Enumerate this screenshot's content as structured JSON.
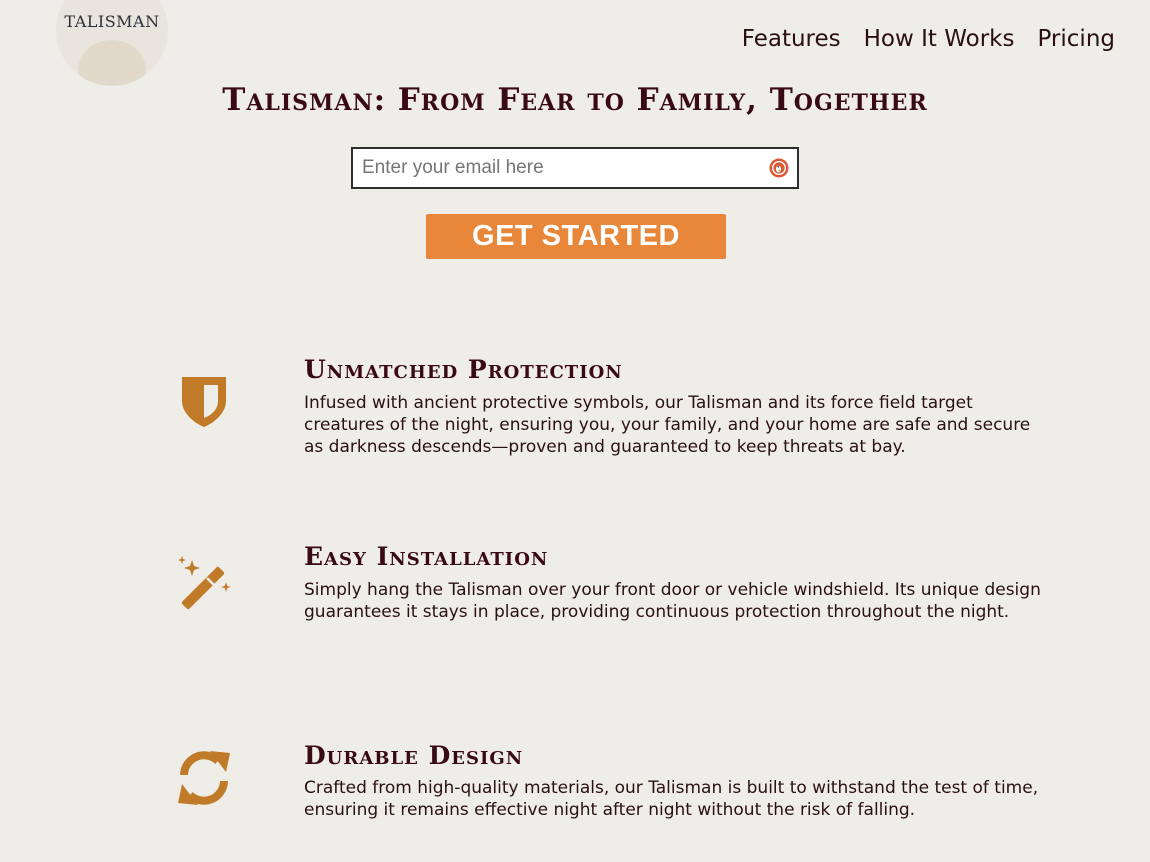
{
  "logo": {
    "text": "TALISMAN"
  },
  "nav": {
    "items": [
      {
        "label": "Features"
      },
      {
        "label": "How It Works"
      },
      {
        "label": "Pricing"
      }
    ]
  },
  "hero": {
    "title": "Talisman: From Fear to Family, Together",
    "email_placeholder": "Enter your email here",
    "email_value": "",
    "cta_label": "GET STARTED"
  },
  "features": [
    {
      "icon": "shield-icon",
      "title": "Unmatched Protection",
      "description": "Infused with ancient protective symbols, our Talisman and its force field target creatures of the night, ensuring you, your family, and your home are safe and secure as darkness descends—proven and guaranteed to keep threats at bay."
    },
    {
      "icon": "magic-wand-icon",
      "title": "Easy Installation",
      "description": "Simply hang the Talisman over your front door or vehicle windshield. Its unique design guarantees it stays in place, providing continuous protection throughout the night."
    },
    {
      "icon": "refresh-icon",
      "title": "Durable Design",
      "description": "Crafted from high-quality materials, our Talisman is built to withstand the test of time, ensuring it remains effective night after night without the risk of falling."
    }
  ],
  "colors": {
    "background": "#efede7",
    "accent": "#e8873a",
    "icon": "#c07a28",
    "heading": "#3a0a14"
  }
}
